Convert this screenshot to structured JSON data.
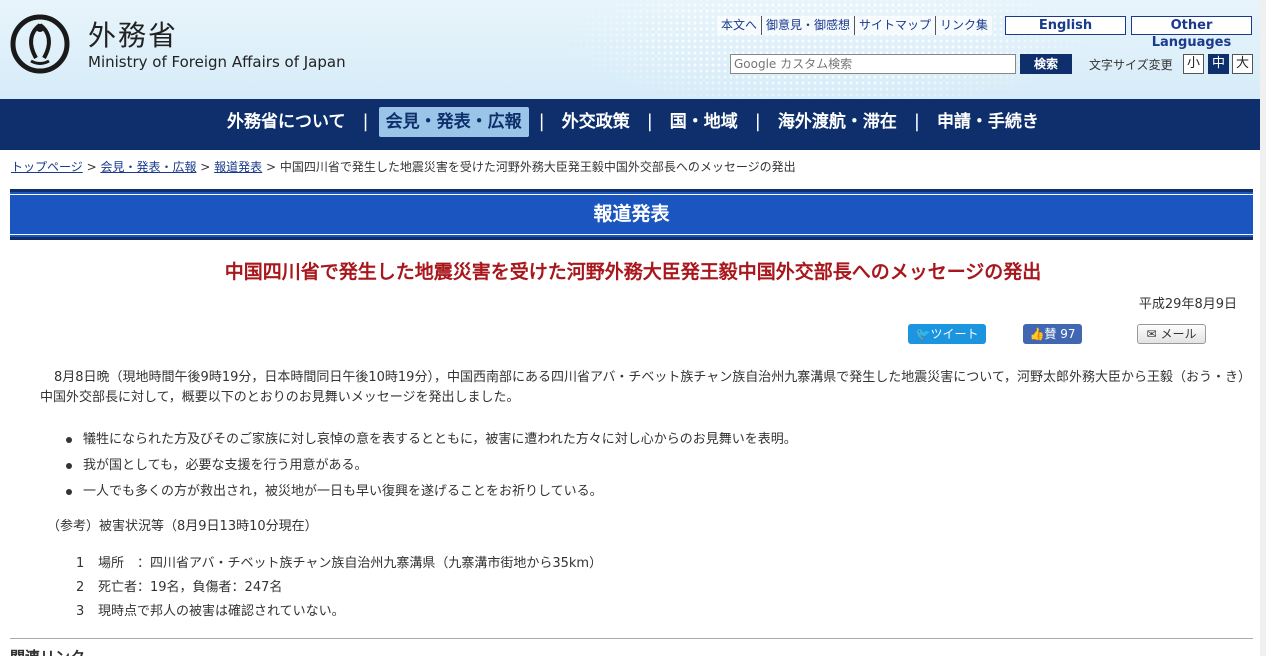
{
  "header": {
    "logo_jp": "外務省",
    "logo_en": "Ministry of Foreign Affairs of Japan",
    "util_links": [
      "本文へ",
      "御意見・御感想",
      "サイトマップ",
      "リンク集"
    ],
    "lang_english": "English",
    "lang_other": "Other Languages",
    "search_placeholder": "Google カスタム検索",
    "search_button": "検索",
    "font_size_label": "文字サイズ変更",
    "font_size_small": "小",
    "font_size_medium": "中",
    "font_size_large": "大"
  },
  "nav": {
    "items": [
      "外務省について",
      "会見・発表・広報",
      "外交政策",
      "国・地域",
      "海外渡航・滞在",
      "申請・手続き"
    ],
    "separator": "|"
  },
  "breadcrumb": {
    "links": [
      "トップページ",
      "会見・発表・広報",
      "報道発表"
    ],
    "current": "中国四川省で発生した地震災害を受けた河野外務大臣発王毅中国外交部長へのメッセージの発出",
    "separator": " > "
  },
  "banner": {
    "title": "報道発表"
  },
  "article": {
    "title": "中国四川省で発生した地震災害を受けた河野外務大臣発王毅中国外交部長へのメッセージの発出",
    "date": "平成29年8月9日",
    "body": "8月8日晩（現地時間午後9時19分，日本時間同日午後10時19分），中国西南部にある四川省アバ・チベット族チャン族自治州九寨溝県で発生した地震災害について，河野太郎外務大臣から王毅（おう・き）中国外交部長に対して，概要以下のとおりのお見舞いメッセージを発出しました。",
    "bullets": [
      "犠牲になられた方及びそのご家族に対し哀悼の意を表するとともに，被害に遭われた方々に対し心からのお見舞いを表明。",
      "我が国としても，必要な支援を行う用意がある。",
      "一人でも多くの方が救出され，被災地が一日も早い復興を遂げることをお祈りしている。"
    ],
    "reference_heading": "（参考）被害状況等（8月9日13時10分現在）",
    "numbered": [
      {
        "num": "1",
        "text": "場所　：四川省アバ・チベット族チャン族自治州九寨溝県（九寨溝市街地から35km）"
      },
      {
        "num": "2",
        "text": "死亡者：19名，負傷者：247名"
      },
      {
        "num": "3",
        "text": "現時点で邦人の被害は確認されていない。"
      }
    ],
    "related_heading": "関連リンク"
  },
  "social": {
    "tweet": "ツイート",
    "like": "賛 97",
    "mail": "メール"
  },
  "colors": {
    "navy": "#0e2f6b",
    "banner_blue": "#1a55c0",
    "title_red": "#a8171c",
    "twitter": "#1b95e0",
    "facebook": "#4267b2"
  }
}
